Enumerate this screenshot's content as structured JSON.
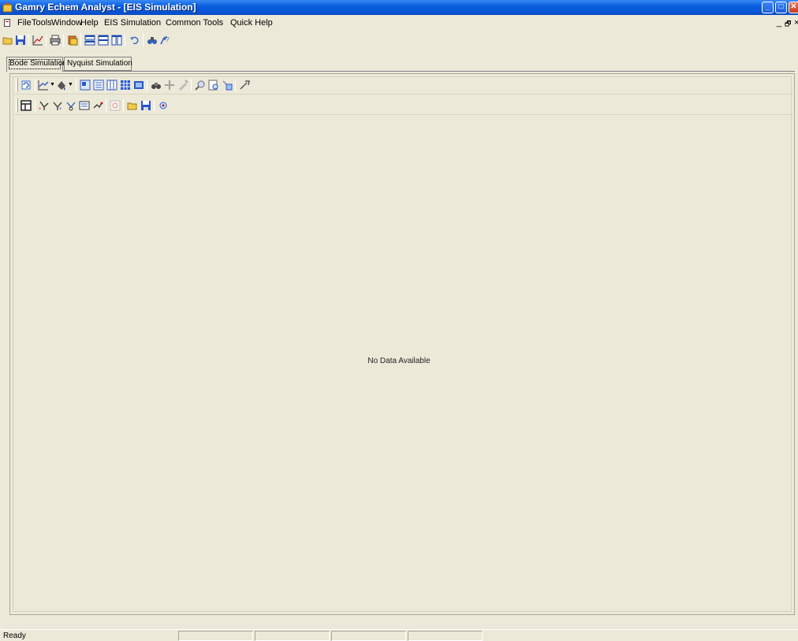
{
  "window": {
    "title": "Gamry Echem Analyst - [EIS Simulation]",
    "controls": {
      "minimize": "_",
      "maximize": "□",
      "close": "✕"
    },
    "icon": "app-icon"
  },
  "menubar": {
    "items": [
      "File",
      "Tools",
      "Window",
      "Help",
      "EIS Simulation",
      "Common Tools",
      "Quick Help"
    ],
    "mdi_minimize": "_",
    "mdi_restore": "🗗",
    "mdi_close": "×"
  },
  "toolbar_main": {
    "icons": [
      "open-icon",
      "save-icon",
      "graph-icon",
      "print-icon",
      "copy-icon",
      "tile-horizontal-icon",
      "tile-vertical-icon",
      "tile-columns-icon",
      "undo-icon",
      "binoculars-icon",
      "help-icon"
    ]
  },
  "tabs": [
    {
      "label": "Bode Simulation",
      "active": true
    },
    {
      "label": "Nyquist Simulation",
      "active": false
    }
  ],
  "chart_toolbar": {
    "icons": [
      "refresh-icon",
      "line-chart-icon",
      "fill-icon",
      "page-icon",
      "page-data-icon",
      "grid-icon",
      "table-icon",
      "image-icon",
      "binoculars-icon",
      "move-icon",
      "pencil-icon",
      "zoom-icon",
      "zoom-page-icon",
      "zoom-reset-icon",
      "pointer-icon"
    ]
  },
  "sim_toolbar": {
    "icons": [
      "layout-icon",
      "fit-1-icon",
      "fit-2-icon",
      "fit-3-icon",
      "fit-4-icon",
      "fit-5-icon",
      "stop-icon",
      "open-folder-icon",
      "save-icon",
      "settings-icon"
    ]
  },
  "content": {
    "empty_message": "No Data Available"
  },
  "statusbar": {
    "text": "Ready"
  },
  "colors": {
    "titlebar": "#0a5fe0",
    "face": "#ece9d8",
    "close": "#c73b1e"
  }
}
